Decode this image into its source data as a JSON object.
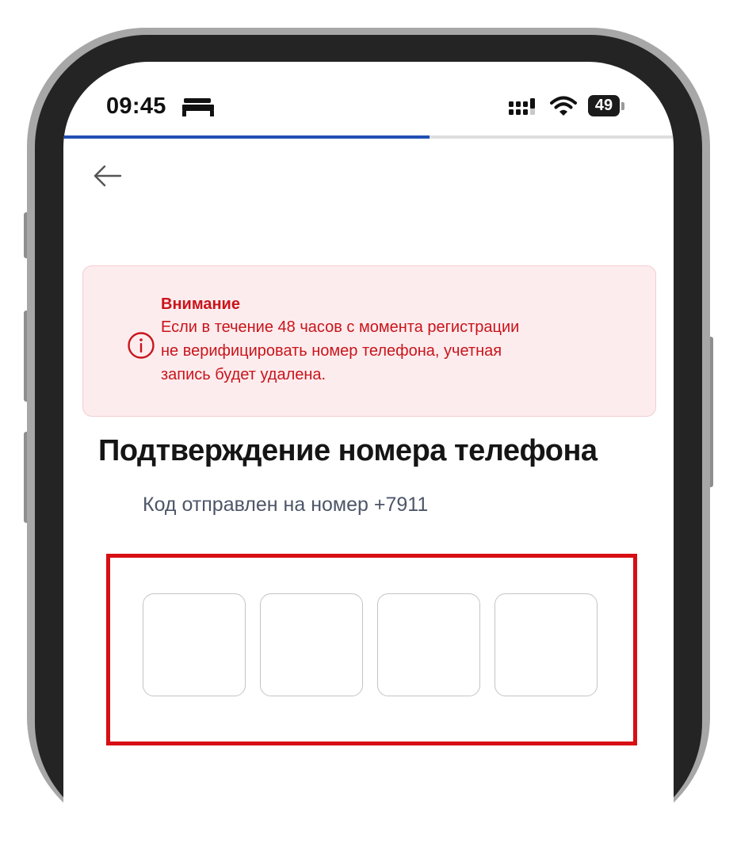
{
  "status_bar": {
    "time": "09:45",
    "status_icon": "bed-icon",
    "signal_icon": "cellular-signal-icon",
    "wifi_icon": "wifi-icon",
    "battery_level": "49"
  },
  "progress": {
    "fraction": 0.6,
    "color": "#1f4eb4"
  },
  "navigation": {
    "back_icon": "arrow-left-icon"
  },
  "alert": {
    "icon": "info-circle-icon",
    "title": "Внимание",
    "lines": [
      "Если в течение 48 часов с момента регистрации",
      "не верифицировать номер телефона, учетная",
      "запись будет удалена."
    ],
    "text_color": "#c8151b",
    "background_color": "#fdecee"
  },
  "main": {
    "title": "Подтверждение номера телефона",
    "subtitle": "Код отправлен на номер +7911"
  },
  "code_input": {
    "digits": [
      "",
      "",
      "",
      ""
    ],
    "highlight_color": "#d70f14"
  }
}
